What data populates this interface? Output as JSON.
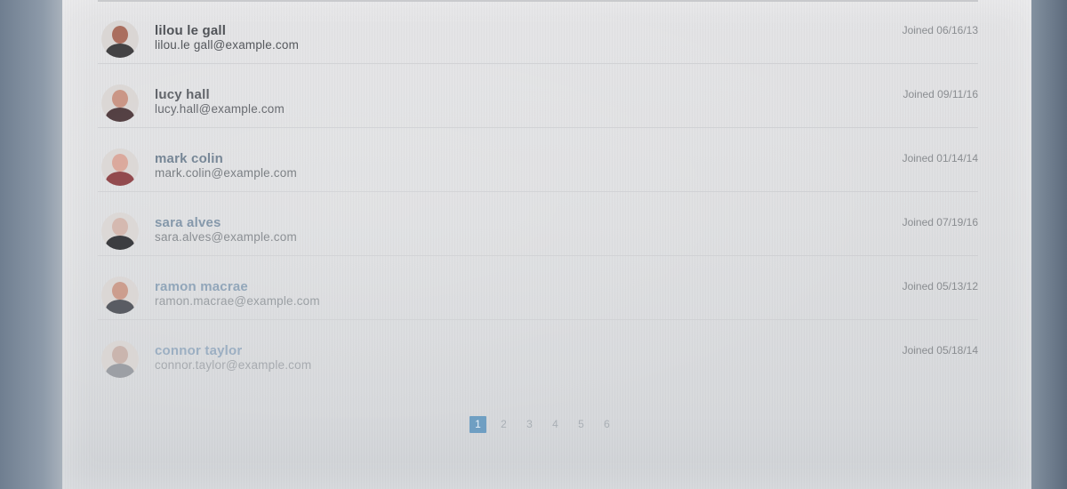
{
  "users": [
    {
      "name": "lilou le gall",
      "email": "lilou.le gall@example.com",
      "joined": "Joined 06/16/13",
      "avatar_icon": "user-avatar-icon",
      "name_color": "#4a4d52",
      "email_color": "#4d5055",
      "skin": "#a86a5a",
      "shirt": "#3c3b3d"
    },
    {
      "name": "lucy hall",
      "email": "lucy.hall@example.com",
      "joined": "Joined 09/11/16",
      "avatar_icon": "user-avatar-icon",
      "name_color": "#575b61",
      "email_color": "#5d6066",
      "skin": "#c7907f",
      "shirt": "#4a3538"
    },
    {
      "name": "mark colin",
      "email": "mark.colin@example.com",
      "joined": "Joined 01/14/14",
      "avatar_icon": "user-avatar-icon",
      "name_color": "#6b7c8d",
      "email_color": "#6e7378",
      "skin": "#d8a396",
      "shirt": "#8a3c40"
    },
    {
      "name": "sara alves",
      "email": "sara.alves@example.com",
      "joined": "Joined 07/19/16",
      "avatar_icon": "user-avatar-icon",
      "name_color": "#7a8fa3",
      "email_color": "#80858a",
      "skin": "#d2b4aa",
      "shirt": "#2e2f33"
    },
    {
      "name": "ramon macrae",
      "email": "ramon.macrae@example.com",
      "joined": "Joined 05/13/12",
      "avatar_icon": "user-avatar-icon",
      "name_color": "#8aa0b5",
      "email_color": "#94999e",
      "skin": "#c99888",
      "shirt": "#51545b"
    },
    {
      "name": "connor taylor",
      "email": "connor.taylor@example.com",
      "joined": "Joined 05/18/14",
      "avatar_icon": "user-avatar-icon",
      "name_color": "#98acc0",
      "email_color": "#a4a8ad",
      "skin": "#c8b3ac",
      "shirt": "#9a9da3"
    }
  ],
  "pagination": {
    "pages": [
      "1",
      "2",
      "3",
      "4",
      "5",
      "6"
    ],
    "current": "1",
    "accent_color": "#6e9ec2"
  }
}
